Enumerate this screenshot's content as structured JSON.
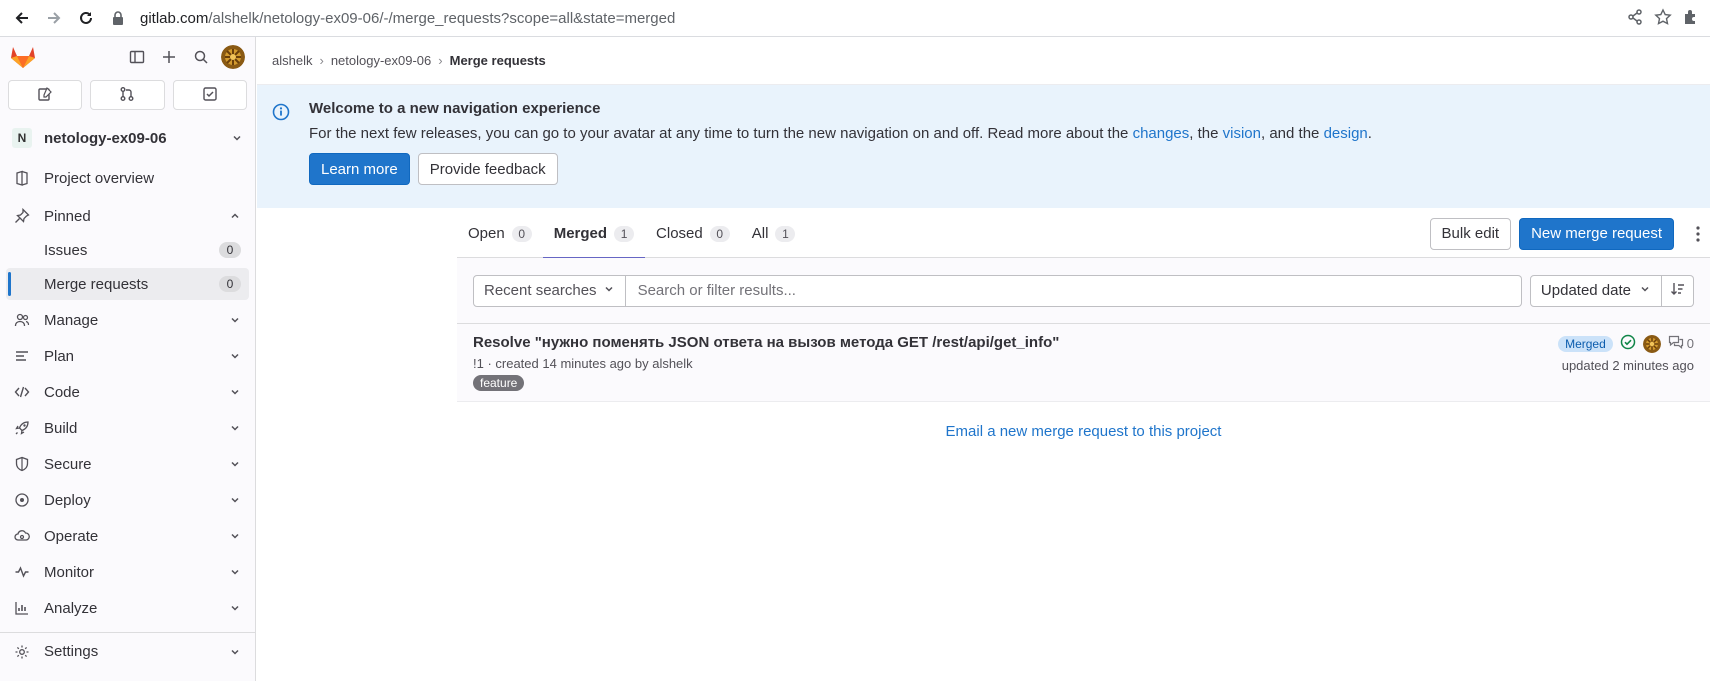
{
  "browser": {
    "url_host": "gitlab.com",
    "url_path": "/alshelk/netology-ex09-06/-/merge_requests?scope=all&state=merged"
  },
  "sidebar": {
    "project_initial": "N",
    "project_name": "netology-ex09-06",
    "project_overview": "Project overview",
    "pinned": "Pinned",
    "pinned_items": [
      {
        "label": "Issues",
        "count": "0"
      },
      {
        "label": "Merge requests",
        "count": "0"
      }
    ],
    "sections": [
      "Manage",
      "Plan",
      "Code",
      "Build",
      "Secure",
      "Deploy",
      "Operate",
      "Monitor",
      "Analyze",
      "Settings"
    ]
  },
  "breadcrumb": {
    "items": [
      "alshelk",
      "netology-ex09-06"
    ],
    "current": "Merge requests"
  },
  "banner": {
    "title": "Welcome to a new navigation experience",
    "text_before": "For the next few releases, you can go to your avatar at any time to turn the new navigation on and off. Read more about the ",
    "link1": "changes",
    "text_mid1": ", the ",
    "link2": "vision",
    "text_mid2": ", and the ",
    "link3": "design",
    "text_after": ".",
    "learn_more": "Learn more",
    "feedback": "Provide feedback"
  },
  "tabs": [
    {
      "label": "Open",
      "count": "0"
    },
    {
      "label": "Merged",
      "count": "1"
    },
    {
      "label": "Closed",
      "count": "0"
    },
    {
      "label": "All",
      "count": "1"
    }
  ],
  "actions": {
    "bulk_edit": "Bulk edit",
    "new_mr": "New merge request"
  },
  "filter": {
    "recent": "Recent searches",
    "placeholder": "Search or filter results...",
    "sort": "Updated date"
  },
  "merge_request": {
    "title": "Resolve \"нужно поменять JSON ответа на вызов метода GET /rest/api/get_info\"",
    "meta": "!1 · created 14 minutes ago by alshelk",
    "label": "feature",
    "status": "Merged",
    "comments": "0",
    "updated": "updated 2 minutes ago"
  },
  "email_link": "Email a new merge request to this project",
  "colors": {
    "accent": "#1f75cb",
    "active_tab": "#6666c4",
    "banner_bg": "#e9f3fc",
    "success": "#108548",
    "gitlab_orange": "#fc6d26"
  }
}
